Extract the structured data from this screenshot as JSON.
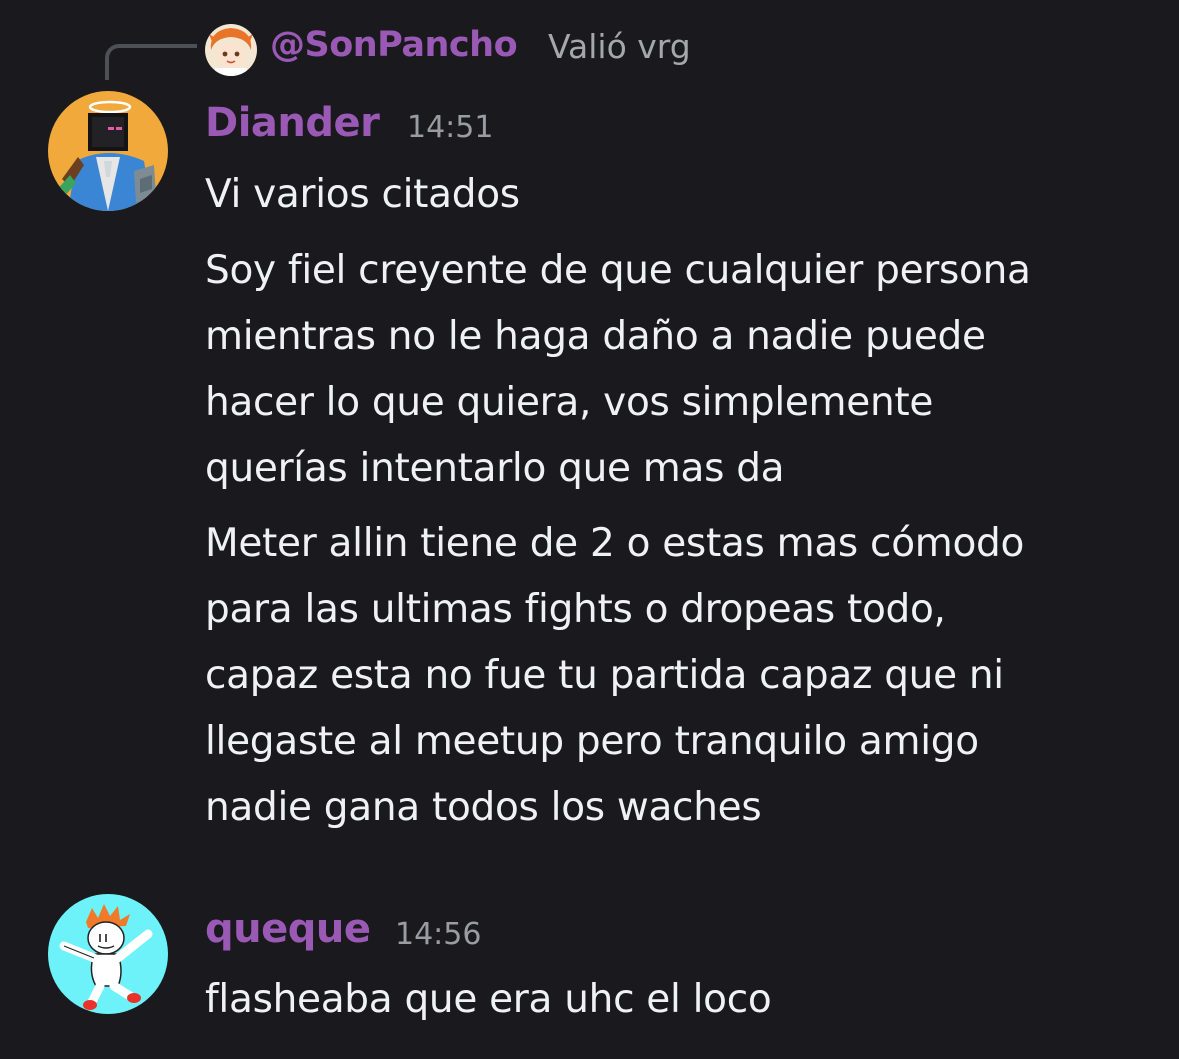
{
  "reply": {
    "author": "@SonPancho",
    "snippet": "Valió vrg",
    "avatar_icon": "orange-haired-character-avatar-icon"
  },
  "messages": [
    {
      "author": "Diander",
      "timestamp": "14:51",
      "avatar_icon": "minecraft-character-avatar-icon",
      "lines": [
        "Vi varios citados",
        "Soy fiel creyente de que cualquier persona",
        "mientras no le haga daño a nadie puede",
        "hacer lo que quiera, vos simplemente",
        "querías intentarlo que mas da",
        "Meter allin tiene de 2 o estas mas cómodo",
        "para las ultimas fights o dropeas todo,",
        "capaz esta no fue tu partida capaz que ni",
        "llegaste al meetup pero tranquilo amigo",
        "nadie gana todos los waches"
      ]
    },
    {
      "author": "queque",
      "timestamp": "14:56",
      "avatar_icon": "dancing-stick-figure-avatar-icon",
      "lines": [
        "flasheaba que era uhc el loco"
      ]
    }
  ],
  "colors": {
    "background": "#1a1a1e",
    "author_name": "#9b59b6",
    "message_text": "#f0f1f4",
    "timestamp": "#9a9ca3",
    "reply_snippet": "#a5a7ad"
  }
}
